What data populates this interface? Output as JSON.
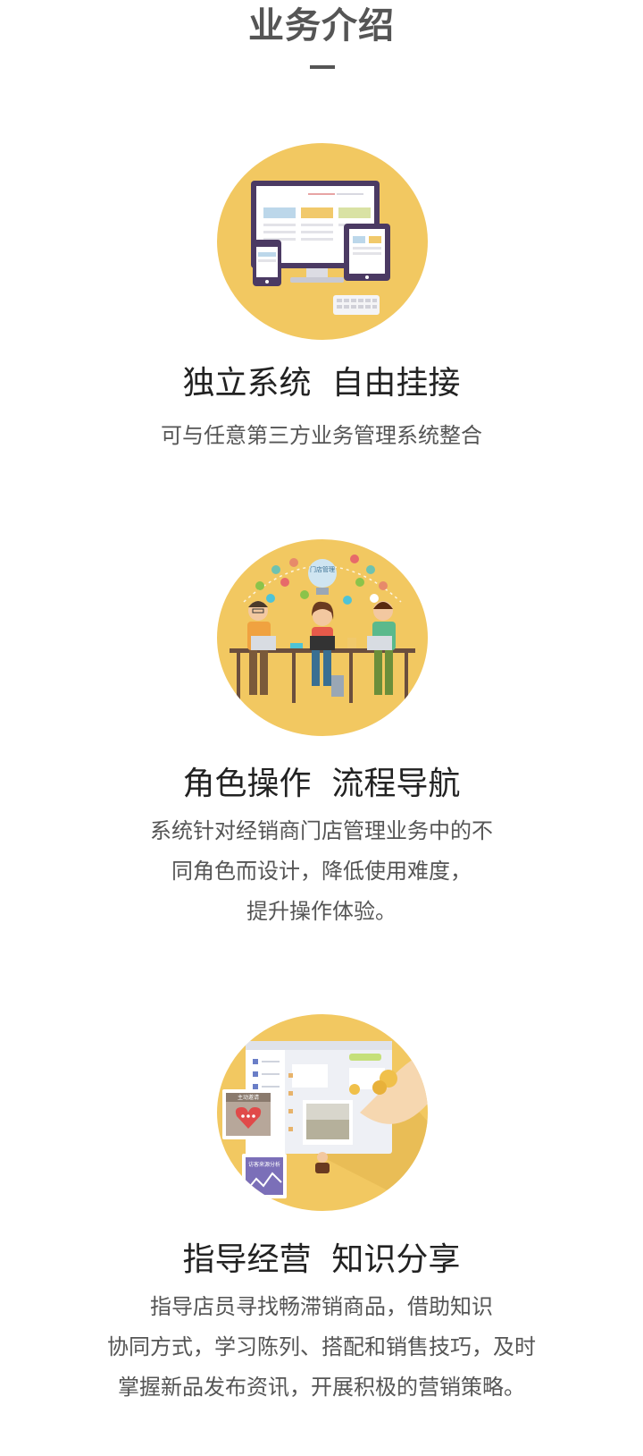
{
  "page_title": "业务介绍",
  "colors": {
    "accent": "#f2c861",
    "title": "#555555",
    "heading": "#222222",
    "text": "#555555"
  },
  "sections": [
    {
      "illustration": "devices-icon",
      "heading": "独立系统  自由挂接",
      "lines": [
        "可与任意第三方业务管理系统整合"
      ]
    },
    {
      "illustration": "team-icon",
      "bulb_label": "门店管理",
      "heading": "角色操作  流程导航",
      "lines": [
        "系统针对经销商门店管理业务中的不",
        "同角色而设计，降低使用难度，",
        "提升操作体验。"
      ]
    },
    {
      "illustration": "marketing-icon",
      "card_label_1": "主动邀请",
      "card_label_2": "访客来源分析",
      "heading": "指导经营  知识分享",
      "lines": [
        "指导店员寻找畅滞销商品，借助知识",
        "协同方式，学习陈列、搭配和销售技巧，及时",
        "掌握新品发布资讯，开展积极的营销策略。"
      ]
    }
  ]
}
